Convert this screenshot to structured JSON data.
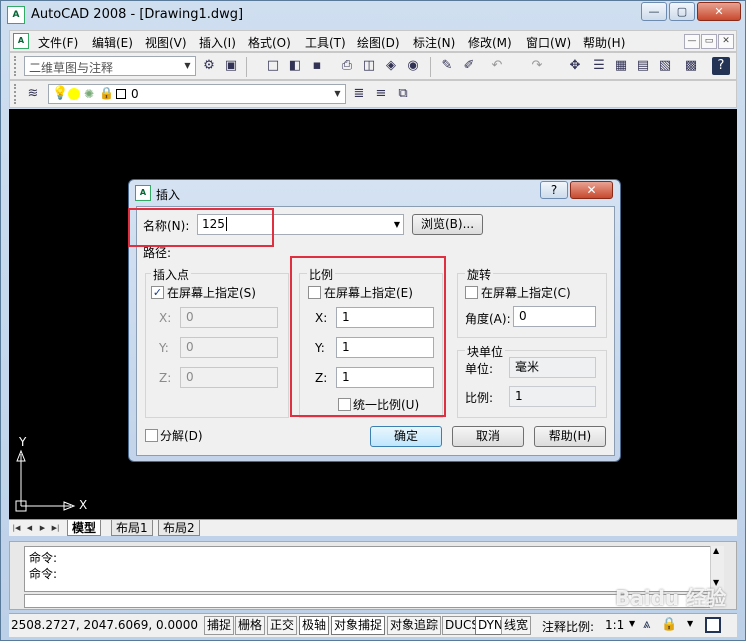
{
  "app": {
    "title": "AutoCAD 2008 - [Drawing1.dwg]",
    "icon_text": "A",
    "window_controls": {
      "minimize": "—",
      "maximize": "▢",
      "close": "✕"
    }
  },
  "menubar": {
    "items": [
      "文件(F)",
      "编辑(E)",
      "视图(V)",
      "插入(I)",
      "格式(O)",
      "工具(T)",
      "绘图(D)",
      "标注(N)",
      "修改(M)",
      "窗口(W)",
      "帮助(H)"
    ],
    "mdi_controls": {
      "minimize": "—",
      "restore": "▭",
      "close": "✕"
    }
  },
  "toolbar1": {
    "workspace": "二维草图与注释"
  },
  "toolbar2": {
    "layer": "0"
  },
  "layout_tabs": {
    "tabs": [
      "模型",
      "布局1",
      "布局2"
    ]
  },
  "ucs": {
    "x_label": "X",
    "y_label": "Y"
  },
  "command": {
    "lines": [
      "命令:",
      "命令:"
    ]
  },
  "status": {
    "coords": "2508.2727, 2047.6069, 0.0000",
    "buttons": [
      "捕捉",
      "栅格",
      "正交",
      "极轴",
      "对象捕捉",
      "对象追踪",
      "DUCS",
      "DYN",
      "线宽"
    ],
    "annotation_scale_label": "注释比例:",
    "annotation_scale_value": "1:1"
  },
  "dialog": {
    "title": "插入",
    "name_label": "名称(N):",
    "name_value": "125",
    "browse_label": "浏览(B)...",
    "path_label": "路径:",
    "insertion": {
      "title": "插入点",
      "onscreen_label": "在屏幕上指定(S)",
      "onscreen_checked": true,
      "x_label": "X:",
      "x_value": "0",
      "y_label": "Y:",
      "y_value": "0",
      "z_label": "Z:",
      "z_value": "0"
    },
    "scale": {
      "title": "比例",
      "onscreen_label": "在屏幕上指定(E)",
      "onscreen_checked": false,
      "x_label": "X:",
      "x_value": "1",
      "y_label": "Y:",
      "y_value": "1",
      "z_label": "Z:",
      "z_value": "1",
      "uniform_label": "统一比例(U)",
      "uniform_checked": false
    },
    "rotation": {
      "title": "旋转",
      "onscreen_label": "在屏幕上指定(C)",
      "onscreen_checked": false,
      "angle_label": "角度(A):",
      "angle_value": "0"
    },
    "block_unit": {
      "title": "块单位",
      "unit_label": "单位:",
      "unit_value": "毫米",
      "factor_label": "比例:",
      "factor_value": "1"
    },
    "explode_label": "分解(D)",
    "explode_checked": false,
    "ok_label": "确定",
    "cancel_label": "取消",
    "help_label": "帮助(H)"
  },
  "watermark": "Baidu 经验"
}
